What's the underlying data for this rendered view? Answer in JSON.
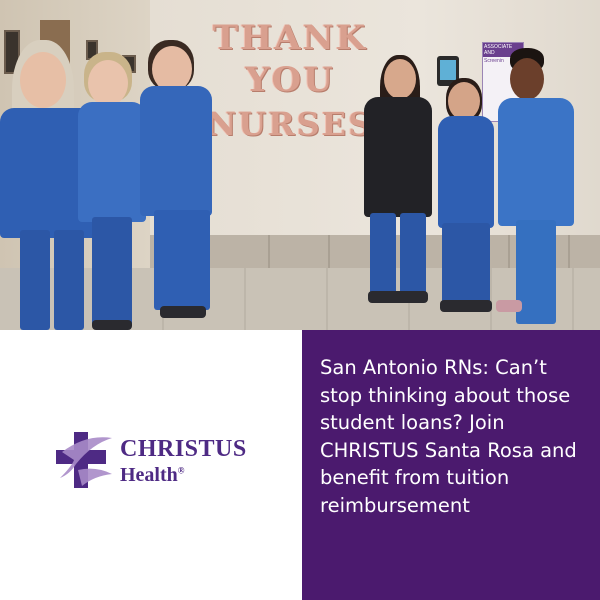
{
  "photo": {
    "balloon_line1": "THANK",
    "balloon_line2": "YOU",
    "balloon_line3": "NURSES",
    "sign_heading": "ASSOCIATE AND",
    "sign_subheading": "Screenin",
    "colors": {
      "scrubs_blue": "#2f5fb3",
      "balloon_rose_gold": "#d9a08f"
    }
  },
  "logo": {
    "brand_line1": "CHRISTUS",
    "brand_line2": "Health",
    "registered_mark": "®",
    "icon": "christus-cross-icon",
    "colors": {
      "purple": "#4e2a84",
      "light_purple": "#a98bc8"
    }
  },
  "message": {
    "text": "San Antonio RNs: Can’t stop thinking about those student loans? Join CHRISTUS Santa Rosa and benefit from tuition reimbursement",
    "background": "#4b1a6e"
  }
}
